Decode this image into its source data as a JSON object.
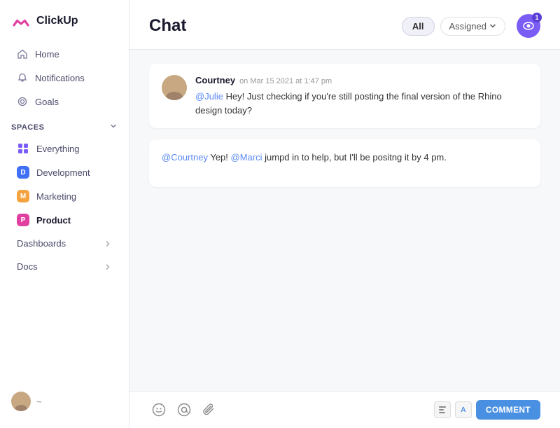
{
  "logo": {
    "text": "ClickUp"
  },
  "sidebar": {
    "nav": [
      {
        "id": "home",
        "label": "Home",
        "icon": "home"
      },
      {
        "id": "notifications",
        "label": "Notifications",
        "icon": "bell"
      },
      {
        "id": "goals",
        "label": "Goals",
        "icon": "target"
      }
    ],
    "spaces_label": "Spaces",
    "spaces": [
      {
        "id": "everything",
        "label": "Everything",
        "type": "grid"
      },
      {
        "id": "development",
        "label": "Development",
        "badge": "D",
        "color": "blue"
      },
      {
        "id": "marketing",
        "label": "Marketing",
        "badge": "M",
        "color": "orange"
      },
      {
        "id": "product",
        "label": "Product",
        "badge": "P",
        "color": "pink",
        "active": true
      }
    ],
    "sections": [
      {
        "id": "dashboards",
        "label": "Dashboards"
      },
      {
        "id": "docs",
        "label": "Docs"
      }
    ],
    "user_hint": "~"
  },
  "header": {
    "title": "Chat",
    "filter_all": "All",
    "filter_assigned": "Assigned",
    "eye_count": "1"
  },
  "messages": [
    {
      "id": "msg1",
      "author": "Courtney",
      "time": "on Mar 15 2021 at 1:47 pm",
      "text_parts": [
        {
          "type": "mention",
          "text": "@Julie"
        },
        {
          "type": "plain",
          "text": " Hey! Just checking if you're still posting the final version of the Rhino design today?"
        }
      ]
    }
  ],
  "reply": {
    "text_parts": [
      {
        "type": "mention",
        "text": "@Courtney"
      },
      {
        "type": "plain",
        "text": " Yep! "
      },
      {
        "type": "mention",
        "text": "@Marci"
      },
      {
        "type": "plain",
        "text": " jumpd in to help, but I'll be positng it by 4 pm."
      }
    ]
  },
  "input_bar": {
    "comment_label": "COMMENT"
  }
}
